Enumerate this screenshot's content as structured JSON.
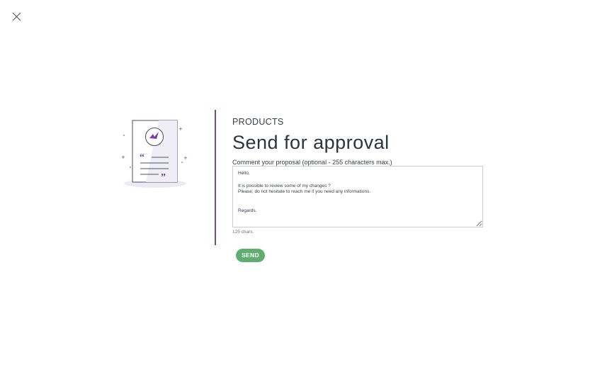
{
  "header": {
    "close_icon": "close-icon"
  },
  "illustration": {
    "icon": "document-approval-icon",
    "accent_color": "#7b3fa0"
  },
  "main": {
    "eyebrow": "PRODUCTS",
    "title": "Send for approval",
    "hint": "Comment your proposal (optional - 255 characters max.)",
    "comment_value": "Hello,\n\nIt is possible to review some of my changes ?\nPlease, do not hesitate to reach me if you need any informations.\n\n\nRegards.",
    "char_count": "125 chars.",
    "send_label": "SEND"
  },
  "colors": {
    "divider": "#7b4a86",
    "send_button": "#5fae6f"
  }
}
